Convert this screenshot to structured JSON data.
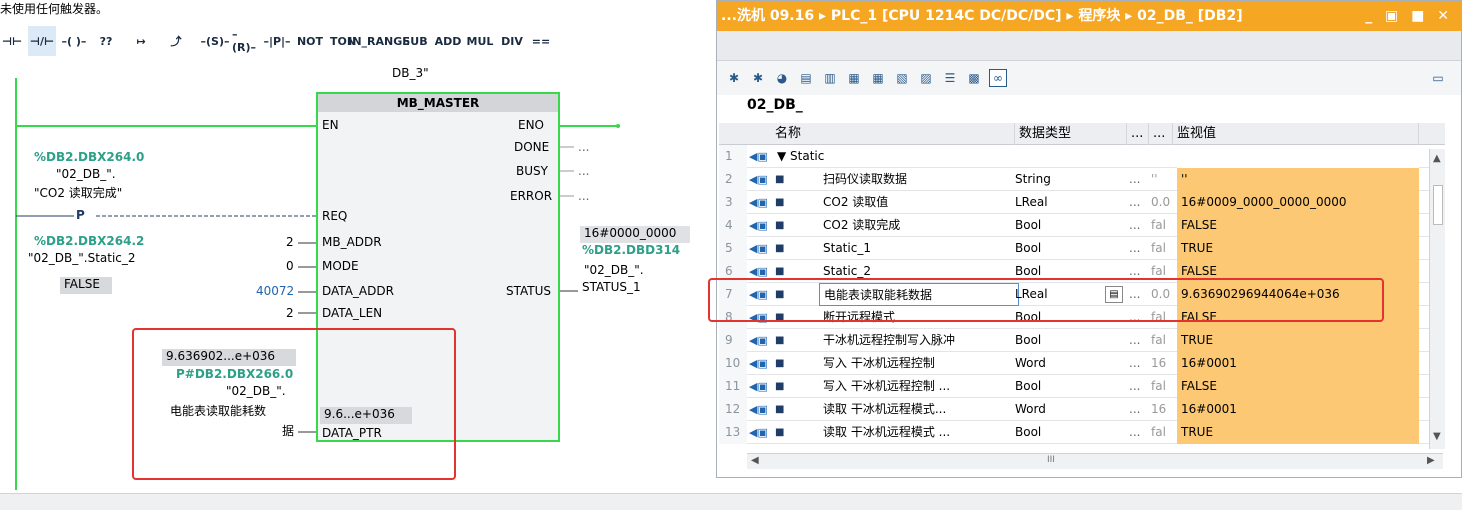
{
  "ladder": {
    "hint": "未使用任何触发器。",
    "toolbar": [
      "⊣⊢",
      "⊣/⊢",
      "–( )–",
      "??",
      "↦",
      "⤴",
      "–(S)–",
      "–(R)–",
      "–|P|–",
      "NOT",
      "TON",
      "IN_RANGE",
      "SUB",
      "ADD",
      "MUL",
      "DIV",
      "=="
    ],
    "instance_db": "DB_3\"",
    "block_title": "MB_MASTER",
    "pins_left": [
      "EN",
      "REQ",
      "MB_ADDR",
      "MODE",
      "DATA_ADDR",
      "DATA_LEN",
      "DATA_PTR"
    ],
    "pins_right": [
      "ENO",
      "DONE",
      "BUSY",
      "ERROR",
      "STATUS"
    ],
    "out_dots": [
      "...",
      "...",
      "..."
    ],
    "req_addr": "%DB2.DBX264.0",
    "req_sym1": "\"02_DB_\".",
    "req_sym2": "\"CO2 读取完成\"",
    "p_contact": "P",
    "p_addr": "%DB2.DBX264.2",
    "p_sym": "\"02_DB_\".Static_2",
    "p_value": "FALSE",
    "mb_addr": "2",
    "mode": "0",
    "data_addr": "40072",
    "data_len": "2",
    "ptr_value": "9.636902...e+036",
    "ptr_addr": "P#DB2.DBX266.0",
    "ptr_sym1": "\"02_DB_\".",
    "ptr_sym2": "电能表读取能耗数",
    "ptr_sym3": "据",
    "ptr_inline": "9.6...e+036",
    "status_value": "16#0000_0000",
    "status_addr": "%DB2.DBD314",
    "status_sym1": "\"02_DB_\".",
    "status_sym2": "STATUS_1"
  },
  "window": {
    "title": "...洗机 09.16 ▸ PLC_1 [CPU 1214C DC/DC/DC] ▸ 程序块 ▸ 02_DB_ [DB2]",
    "controls": "_ ▣ ■ ✕",
    "block_name": "02_DB_",
    "col_name": "名称",
    "col_type": "数据类型",
    "col_dots1": "...",
    "col_dots2": "...",
    "col_monitor": "监视值",
    "rows": [
      {
        "n": "1",
        "name": "▼ Static",
        "type": "",
        "dt": "",
        "st": "",
        "mv": ""
      },
      {
        "n": "2",
        "name": "扫码仪读取数据",
        "type": "String",
        "dt": "...",
        "st": "''",
        "mv": "''"
      },
      {
        "n": "3",
        "name": "CO2 读取值",
        "type": "LReal",
        "dt": "...",
        "st": "0.0",
        "mv": "16#0009_0000_0000_0000"
      },
      {
        "n": "4",
        "name": "CO2 读取完成",
        "type": "Bool",
        "dt": "...",
        "st": "fal",
        "mv": "FALSE"
      },
      {
        "n": "5",
        "name": "Static_1",
        "type": "Bool",
        "dt": "...",
        "st": "fal",
        "mv": "TRUE"
      },
      {
        "n": "6",
        "name": "Static_2",
        "type": "Bool",
        "dt": "...",
        "st": "fal",
        "mv": "FALSE"
      },
      {
        "n": "7",
        "name": "电能表读取能耗数据",
        "type": "LReal",
        "dt": "...",
        "st": "0.0",
        "mv": "9.63690296944064e+036"
      },
      {
        "n": "8",
        "name": "断开远程模式",
        "type": "Bool",
        "dt": "...",
        "st": "fal",
        "mv": "FALSE"
      },
      {
        "n": "9",
        "name": "干冰机远程控制写入脉冲",
        "type": "Bool",
        "dt": "...",
        "st": "fal",
        "mv": "TRUE"
      },
      {
        "n": "10",
        "name": "写入 干冰机远程控制",
        "type": "Word",
        "dt": "...",
        "st": "16",
        "mv": "16#0001"
      },
      {
        "n": "11",
        "name": "写入 干冰机远程控制 ...",
        "type": "Bool",
        "dt": "...",
        "st": "fal",
        "mv": "FALSE"
      },
      {
        "n": "12",
        "name": "读取 干冰机远程模式...",
        "type": "Word",
        "dt": "...",
        "st": "16",
        "mv": "16#0001"
      },
      {
        "n": "13",
        "name": "读取 干冰机远程模式 ...",
        "type": "Bool",
        "dt": "...",
        "st": "fal",
        "mv": "TRUE"
      }
    ],
    "scrollbar_grip": "III"
  },
  "colors": {
    "accent": "#f5a623",
    "monitor": "#fcc873",
    "highlight_box": "#e4332e",
    "wire": "#37d84a",
    "address": "#2ea08a"
  }
}
